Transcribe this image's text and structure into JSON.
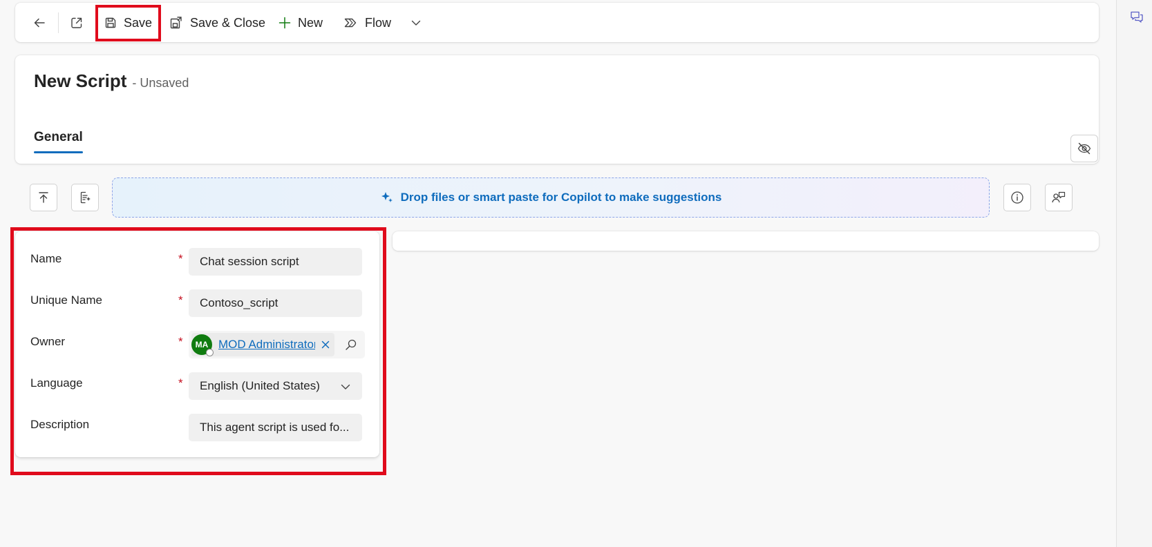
{
  "commandbar": {
    "save_label": "Save",
    "save_close_label": "Save & Close",
    "new_label": "New",
    "flow_label": "Flow"
  },
  "header": {
    "title": "New Script",
    "status": "- Unsaved",
    "tabs": [
      {
        "label": "General",
        "selected": true
      }
    ]
  },
  "copilot": {
    "dropzone_text": "Drop files or smart paste for Copilot to make suggestions"
  },
  "form": {
    "fields": [
      {
        "label": "Name",
        "required": true,
        "value": "Chat session script"
      },
      {
        "label": "Unique Name",
        "required": true,
        "value": "Contoso_script"
      },
      {
        "label": "Owner",
        "required": true,
        "value": "MOD Administrator",
        "avatar_initials": "MA"
      },
      {
        "label": "Language",
        "required": true,
        "value": "English (United States)"
      },
      {
        "label": "Description",
        "required": false,
        "value": "This agent script is used fo..."
      }
    ],
    "required_marker": "*"
  },
  "colors": {
    "accent": "#0f6cbd",
    "highlight": "#e00b1c",
    "required": "#c50f1f",
    "avatar": "#107c10"
  },
  "icons": [
    "back-arrow-icon",
    "open-in-new-window-icon",
    "save-icon",
    "save-close-icon",
    "plus-icon",
    "flow-icon",
    "chevron-down-icon",
    "eye-off-icon",
    "upload-icon",
    "document-sparkle-icon",
    "sparkle-icon",
    "info-icon",
    "person-feedback-icon",
    "close-icon",
    "search-icon",
    "chat-icon"
  ]
}
